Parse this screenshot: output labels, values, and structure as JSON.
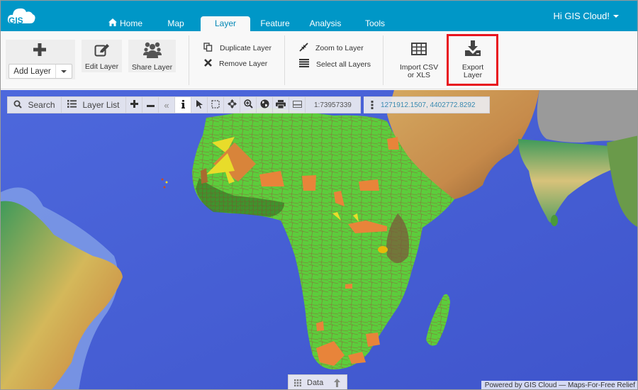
{
  "header": {
    "logo_text": "GIS",
    "nav_tabs": [
      {
        "label": "Home",
        "icon": "home-icon",
        "active": false
      },
      {
        "label": "Map",
        "active": false
      },
      {
        "label": "Layer",
        "active": true
      },
      {
        "label": "Feature",
        "active": false
      },
      {
        "label": "Analysis",
        "active": false
      },
      {
        "label": "Tools",
        "active": false
      }
    ],
    "user_greeting": "Hi GIS Cloud!"
  },
  "ribbon": {
    "add_layer": {
      "icon": "plus-icon",
      "label": "Add Layer"
    },
    "edit_layer": {
      "icon": "edit-icon",
      "label": "Edit Layer"
    },
    "share_layer": {
      "icon": "users-icon",
      "label": "Share Layer"
    },
    "duplicate_layer": {
      "icon": "copy-icon",
      "label": "Duplicate Layer"
    },
    "remove_layer": {
      "icon": "close-icon",
      "label": "Remove Layer"
    },
    "zoom_to_layer": {
      "icon": "compress-icon",
      "label": "Zoom to Layer"
    },
    "select_all_layers": {
      "icon": "list-icon",
      "label": "Select all Layers"
    },
    "import_csv": {
      "icon": "table-icon",
      "label_line1": "Import CSV",
      "label_line2": "or XLS"
    },
    "export_layer": {
      "icon": "download-icon",
      "label_line1": "Export",
      "label_line2": "Layer",
      "highlighted": true
    },
    "highlight_color": "#e8141e"
  },
  "map_toolbar": {
    "search_label": "Search",
    "layer_list_label": "Layer List",
    "tools": [
      "zoom-in",
      "zoom-out",
      "collapse",
      "info",
      "select",
      "box-select",
      "pan",
      "zoom-box",
      "globe",
      "print",
      "measure"
    ],
    "active_tool": "info",
    "scale": "1:73957339",
    "coordinates": "1271912.1507, 4402772.8292"
  },
  "data_panel": {
    "label": "Data"
  },
  "attribution": "Powered by GIS Cloud — Maps-For-Free Relief",
  "colors": {
    "header_blue": "#0097c7",
    "ocean": "#4a62d8",
    "choropleth_green": "#5ad43a",
    "choropleth_orange": "#e8843a",
    "choropleth_yellow": "#e8dc2a"
  }
}
